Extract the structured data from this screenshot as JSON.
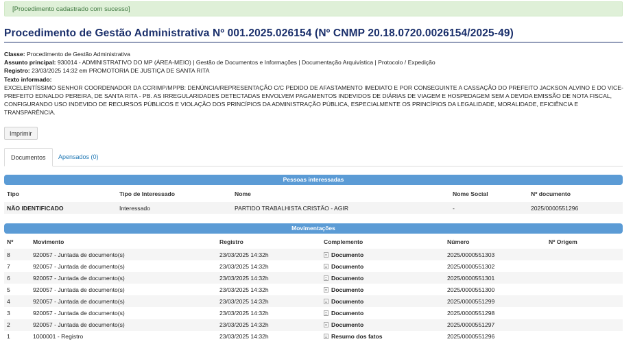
{
  "alert": {
    "message": "[Procedimento cadastrado com sucesso]"
  },
  "page_title": "Procedimento de Gestão Administrativa Nº 001.2025.026154 (Nº CNMP 20.18.0720.0026154/2025-49)",
  "info": {
    "classe_label": "Classe:",
    "classe_value": "Procedimento de Gestão Administrativa",
    "assunto_label": "Assunto principal:",
    "assunto_value": "930014 - ADMINISTRATIVO DO MP (ÁREA-MEIO) | Gestão de Documentos e Informações | Documentação Arquivística | Protocolo / Expedição",
    "registro_label": "Registro:",
    "registro_value": "23/03/2025 14:32 em PROMOTORIA DE JUSTIÇA DE SANTA RITA",
    "texto_label": "Texto informado:",
    "texto_value": "EXCELENTÍSSIMO SENHOR COORDENADOR DA CCRIMP/MPPB: DENÚNCIA/REPRESENTAÇÃO C/C PEDIDO DE AFASTAMENTO IMEDIATO E POR CONSEGUINTE A CASSAÇÃO DO PREFEITO JACKSON ALVINO E DO VICE-PREFEITO EDNALDO PEREIRA, DE SANTA RITA - PB. AS IRREGULARIDADES DETECTADAS ENVOLVEM PAGAMENTOS INDEVIDOS DE DIÁRIAS DE VIAGEM E HOSPEDAGEM SEM A DEVIDA EMISSÃO DE NOTA FISCAL, CONFIGURANDO USO INDEVIDO DE RECURSOS PÚBLICOS E VIOLAÇÃO DOS PRINCÍPIOS DA ADMINISTRAÇÃO PÚBLICA, ESPECIALMENTE OS PRINCÍPIOS DA LEGALIDADE, MORALIDADE, EFICIÊNCIA E TRANSPARÊNCIA."
  },
  "print_label": "Imprimir",
  "tabs": [
    {
      "label": "Documentos"
    },
    {
      "label": "Apensados (0)"
    }
  ],
  "pessoas": {
    "title": "Pessoas interessadas",
    "headers": [
      "Tipo",
      "Tipo de Interessado",
      "Nome",
      "Nome Social",
      "Nº documento"
    ],
    "rows": [
      {
        "tipo": "NÃO IDENTIFICADO",
        "tipo_interessado": "Interessado",
        "nome": "PARTIDO TRABALHISTA CRISTÃO - AGIR",
        "nome_social": "-",
        "documento": "2025/0000551296"
      }
    ]
  },
  "movimentacoes": {
    "title": "Movimentações",
    "headers": [
      "Nº",
      "Movimento",
      "Registro",
      "Complemento",
      "Número",
      "Nº Origem"
    ],
    "rows": [
      {
        "n": "8",
        "movimento": "920057 - Juntada de documento(s)",
        "registro": "23/03/2025 14:32h",
        "complemento": "Documento",
        "numero": "2025/0000551303",
        "origem": ""
      },
      {
        "n": "7",
        "movimento": "920057 - Juntada de documento(s)",
        "registro": "23/03/2025 14:32h",
        "complemento": "Documento",
        "numero": "2025/0000551302",
        "origem": ""
      },
      {
        "n": "6",
        "movimento": "920057 - Juntada de documento(s)",
        "registro": "23/03/2025 14:32h",
        "complemento": "Documento",
        "numero": "2025/0000551301",
        "origem": ""
      },
      {
        "n": "5",
        "movimento": "920057 - Juntada de documento(s)",
        "registro": "23/03/2025 14:32h",
        "complemento": "Documento",
        "numero": "2025/0000551300",
        "origem": ""
      },
      {
        "n": "4",
        "movimento": "920057 - Juntada de documento(s)",
        "registro": "23/03/2025 14:32h",
        "complemento": "Documento",
        "numero": "2025/0000551299",
        "origem": ""
      },
      {
        "n": "3",
        "movimento": "920057 - Juntada de documento(s)",
        "registro": "23/03/2025 14:32h",
        "complemento": "Documento",
        "numero": "2025/0000551298",
        "origem": ""
      },
      {
        "n": "2",
        "movimento": "920057 - Juntada de documento(s)",
        "registro": "23/03/2025 14:32h",
        "complemento": "Documento",
        "numero": "2025/0000551297",
        "origem": ""
      },
      {
        "n": "1",
        "movimento": "1000001 - Registro",
        "registro": "23/03/2025 14:32h",
        "complemento": "Resumo dos fatos",
        "numero": "2025/0000551296",
        "origem": ""
      }
    ]
  },
  "icons": {
    "complemento": "document-icon"
  },
  "colors": {
    "section_bar": "#5b9bd5",
    "title": "#1a2f6b",
    "alert_bg": "#dff0d8",
    "alert_text": "#3c763d",
    "link": "#1f77b4"
  }
}
